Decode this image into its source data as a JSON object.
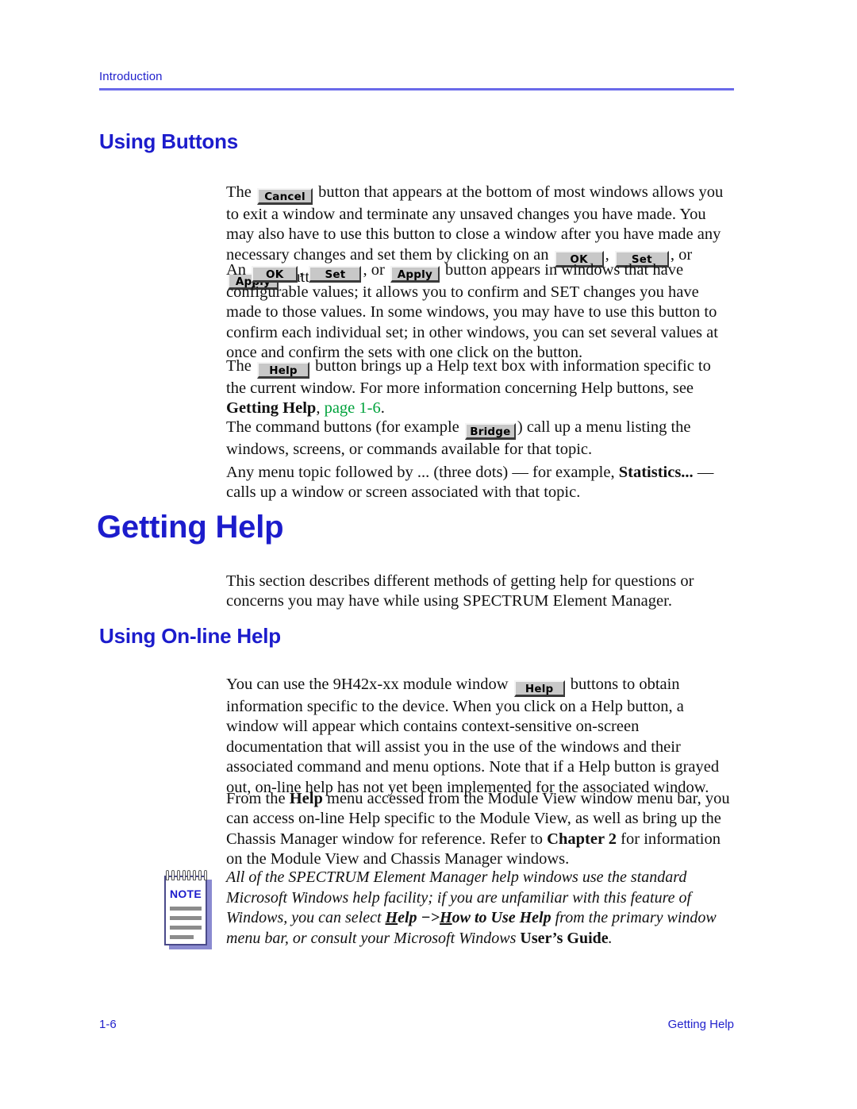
{
  "header": {
    "running_head": "Introduction"
  },
  "headings": {
    "using_buttons": "Using Buttons",
    "getting_help": "Getting Help",
    "using_online_help": "Using On-line Help"
  },
  "buttons": {
    "cancel": "Cancel",
    "ok": "OK",
    "set": "Set",
    "apply": "Apply",
    "help": "Help",
    "bridge": "Bridge"
  },
  "paragraphs": {
    "p1_a": "The ",
    "p1_b": " button that appears at the bottom of most windows allows you to exit a window and terminate any unsaved changes you have made. You may also have to use this button to close a window after you have made any necessary changes and set them by clicking on an ",
    "p1_c": ", ",
    "p1_d": ", or ",
    "p1_e": " button.",
    "p2_a": "An ",
    "p2_b": ", ",
    "p2_c": ", or ",
    "p2_d": " button appears in windows that have configurable values; it allows you to confirm and SET changes you have made to those values. In some windows, you may have to use this button to confirm each individual set; in other windows, you can set several values at once and confirm the sets with one click on the button.",
    "p3_a": "The ",
    "p3_b": " button brings up a Help text box with information specific to the current window. For more information concerning Help buttons, see ",
    "p3_bold": "Getting Help",
    "p3_c": ", ",
    "p3_link": "page 1-6",
    "p3_d": ".",
    "p4_a": "The command buttons (for example ",
    "p4_b": ") call up a menu listing the windows, screens, or commands available for that topic.",
    "p5_a": "Any menu topic followed by ... (three dots) — for example, ",
    "p5_bold": "Statistics...",
    "p5_b": " — calls up a window or screen associated with that topic.",
    "p6": "This section describes different methods of getting help for questions or concerns you may have while using SPECTRUM Element Manager.",
    "p7_a": "You can use the 9H42x-xx module window ",
    "p7_b": " buttons to obtain information specific to the device. When you click on a Help button, a window will appear which contains context-sensitive on-screen documentation that will assist you in the use of the windows and their associated command and menu options. Note that if a Help button is grayed out, on-line help has not yet been implemented for the associated window.",
    "p8_a": "From the ",
    "p8_bold1": "Help",
    "p8_b": " menu accessed from the Module View window menu bar, you can access on-line Help specific to the Module View, as well as bring up the Chassis Manager window for reference. Refer to ",
    "p8_bold2": "Chapter 2",
    "p8_c": " for information on the Module View and Chassis Manager windows."
  },
  "note": {
    "label": "NOTE",
    "t1": "All of the SPECTRUM Element Manager help windows use the standard Microsoft Windows help facility; if you are unfamiliar with this feature of Windows, you can select ",
    "help_h": "H",
    "help_elp": "elp",
    "arrow": " −>",
    "how_h": "H",
    "how_rest": "ow to Use Help",
    "t2": " from the primary window menu bar, or consult your Microsoft Windows ",
    "t3": "User’s Guide",
    "t4": "."
  },
  "footer": {
    "page_number": "1-6",
    "section": "Getting Help"
  },
  "colors": {
    "heading_blue": "#1c1ccc",
    "rule_blue": "#6a6aea",
    "link_green": "#00a23c",
    "note_blue": "#1c1ccc"
  }
}
